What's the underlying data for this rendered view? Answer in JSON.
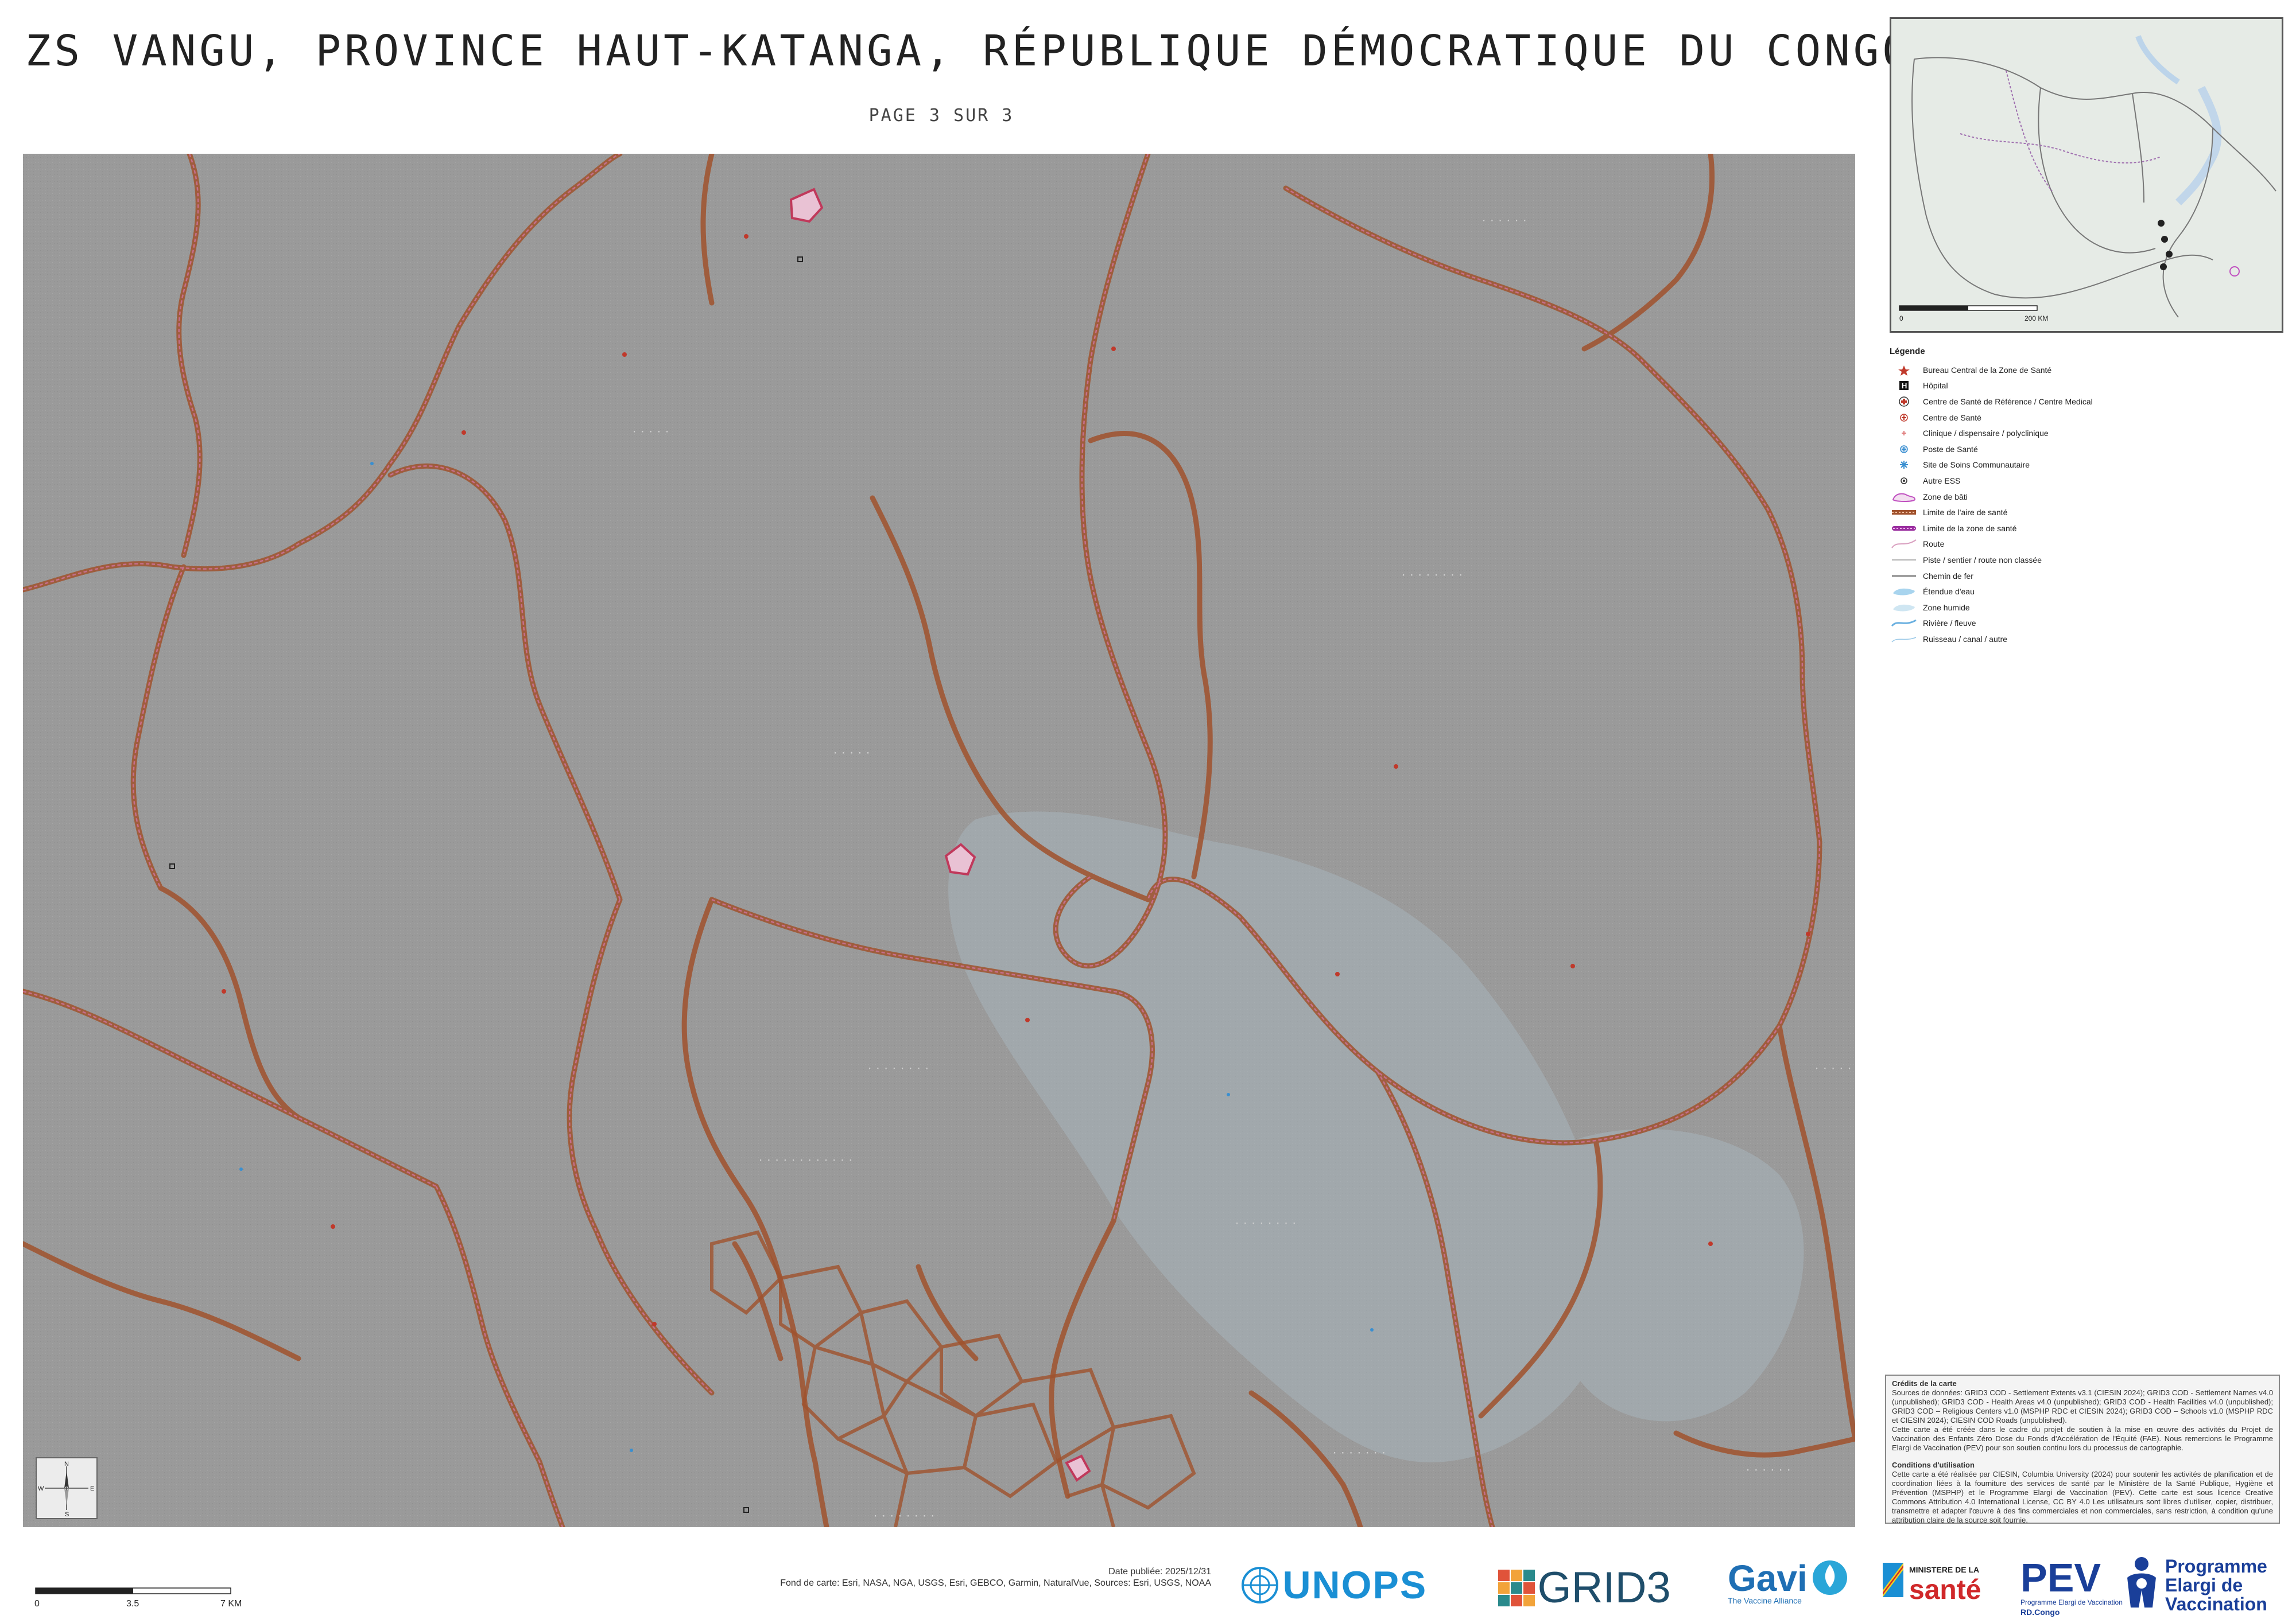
{
  "title": "ZS VANGU, PROVINCE HAUT-KATANGA, RÉPUBLIQUE DÉMOCRATIQUE DU CONGO",
  "page_label": "PAGE 3 SUR 3",
  "inset": {
    "scale_zero": "0",
    "scale_end": "200 KM"
  },
  "legend": {
    "title": "Légende",
    "items": [
      {
        "label": "Bureau Central de la Zone de Santé",
        "icon": "star-icon",
        "color": "#c0392b"
      },
      {
        "label": "Hôpital",
        "icon": "hospital-h-icon",
        "color": "#111111"
      },
      {
        "label": "Centre de Santé de Référence / Centre Medical",
        "icon": "red-cross-circle-icon",
        "color": "#c0392b"
      },
      {
        "label": "Centre de Santé",
        "icon": "health-center-icon",
        "color": "#c0392b"
      },
      {
        "label": "Clinique / dispensaire / polyclinique",
        "icon": "clinic-icon",
        "color": "#e08080"
      },
      {
        "label": "Poste de Santé",
        "icon": "health-post-icon",
        "color": "#3a8fd0"
      },
      {
        "label": "Site de Soins Communautaire",
        "icon": "community-site-icon",
        "color": "#3a8fd0"
      },
      {
        "label": "Autre ESS",
        "icon": "other-facility-icon",
        "color": "#333333"
      },
      {
        "label": "Zone de bâti",
        "icon": "built-area-icon",
        "color": "#c050c0"
      },
      {
        "label": "Limite de l'aire de santé",
        "icon": "health-area-boundary-icon",
        "color": "#a0522d"
      },
      {
        "label": "Limite de la zone de santé",
        "icon": "health-zone-boundary-icon",
        "color": "#9b30a0"
      },
      {
        "label": "Route",
        "icon": "road-icon",
        "color": "#d9a0c0"
      },
      {
        "label": "Piste / sentier / route non classée",
        "icon": "track-icon",
        "color": "#999999"
      },
      {
        "label": "Chemin de fer",
        "icon": "railway-icon",
        "color": "#666666"
      },
      {
        "label": "Étendue d'eau",
        "icon": "water-body-icon",
        "color": "#a8d4ee"
      },
      {
        "label": "Zone humide",
        "icon": "wetland-icon",
        "color": "#cfe6f2"
      },
      {
        "label": "Rivière / fleuve",
        "icon": "river-icon",
        "color": "#6ab0e0"
      },
      {
        "label": "Ruisseau / canal / autre",
        "icon": "stream-icon",
        "color": "#9ccae8"
      }
    ]
  },
  "credits": {
    "heading": "Crédits de la carte",
    "sources": "Sources de données: GRID3 COD - Settlement Extents v3.1 (CIESIN 2024); GRID3 COD - Settlement Names v4.0 (unpublished); GRID3 COD - Health Areas v4.0 (unpublished); GRID3 COD - Health Facilities v4.0 (unpublished); GRID3 COD – Religious Centers v1.0 (MSPHP RDC et CIESIN 2024); GRID3 COD – Schools v1.0 (MSPHP RDC et CIESIN 2024); CIESIN COD Roads (unpublished).",
    "project": "Cette carte a été créée dans le cadre du projet de soutien à la mise en œuvre des activités du Projet de Vaccination des Enfants Zéro Dose du Fonds d'Accélération de l'Équité (FAE). Nous remercions le Programme Elargi de Vaccination (PEV) pour son soutien continu lors du processus de cartographie.",
    "conditions_heading": "Conditions d'utilisation",
    "conditions": "Cette carte a été réalisée par CIESIN, Columbia University (2024) pour soutenir les activités de planification et de coordination liées à la fourniture des services de santé par le Ministère de la Santé Publique, Hygiène et Prévention (MSPHP) et le Programme Elargi de Vaccination (PEV). Cette carte est sous licence Creative Commons Attribution 4.0 International License, CC BY 4.0 Les utilisateurs sont libres d'utiliser, copier, distribuer, transmettre et adapter l'œuvre à des fins commerciales et non commerciales, sans restriction, à condition qu'une attribution claire de la source soit fournie."
  },
  "compass": {
    "n": "N",
    "s": "S",
    "e": "E",
    "w": "W"
  },
  "scalebar": {
    "zero": "0",
    "mid": "3.5",
    "end": "7 KM"
  },
  "footer": {
    "date": "Date publiée: 2025/12/31",
    "basemap": "Fond de carte: Esri, NASA, NGA, USGS, Esri, GEBCO, Garmin, NaturalVue, Sources: Esri, USGS, NOAA"
  },
  "logos": {
    "unops": "UNOPS",
    "grid3": "GRID3",
    "gavi": "Gavi",
    "gavi_sub": "The Vaccine Alliance",
    "ministere": "MINISTERE DE LA",
    "sante": "santé",
    "pev": "PEV",
    "pev_sub1": "Programme Elargi de Vaccination",
    "pev_sub2": "RD.Congo",
    "pev_full": "Programme Elargi de Vaccination"
  },
  "colors": {
    "map_bg": "#9a9a9a",
    "boundary_outer": "#a0522d",
    "boundary_inner": "#c97090",
    "wetland": "#a8b4bc",
    "inset_land": "#e6ebe6",
    "inset_water": "#bcd4ea"
  }
}
